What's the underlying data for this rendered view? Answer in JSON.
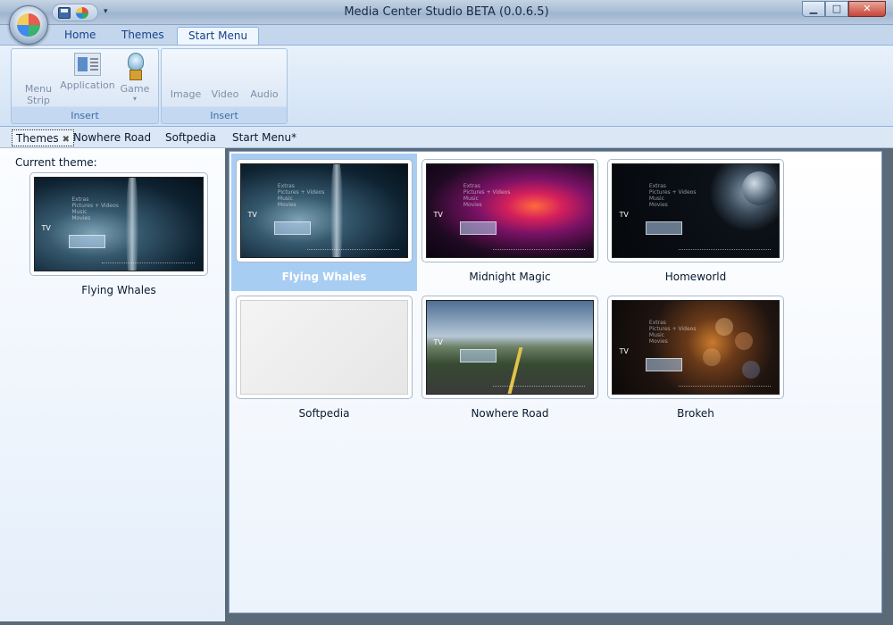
{
  "window": {
    "title": "Media Center Studio BETA (0.0.6.5)",
    "controls": {
      "minimize": "▁",
      "maximize": "□",
      "close": "✕"
    }
  },
  "ribbon": {
    "tabs": [
      {
        "label": "Home",
        "active": false
      },
      {
        "label": "Themes",
        "active": false
      },
      {
        "label": "Start Menu",
        "active": true
      }
    ],
    "groups": [
      {
        "label": "Insert",
        "buttons": [
          {
            "label_line1": "Menu",
            "label_line2": "Strip",
            "icon": "menu-strip-icon"
          },
          {
            "label_line1": "Application",
            "icon": "application-icon"
          },
          {
            "label_line1": "Game",
            "icon": "game-icon",
            "dropdown": "▾"
          }
        ]
      },
      {
        "label": "Insert",
        "buttons": [
          {
            "label_line1": "Image"
          },
          {
            "label_line1": "Video"
          },
          {
            "label_line1": "Audio"
          }
        ]
      }
    ]
  },
  "doc_tabs": [
    {
      "label": "Themes",
      "active": true,
      "close": "✖"
    },
    {
      "label": "Nowhere Road"
    },
    {
      "label": "Softpedia"
    },
    {
      "label": "Start Menu*"
    }
  ],
  "current_theme": {
    "label": "Current theme:",
    "name": "Flying Whales"
  },
  "themes": [
    {
      "name": "Flying Whales",
      "selected": true,
      "preview": "whales"
    },
    {
      "name": "Midnight Magic",
      "selected": false,
      "preview": "magic"
    },
    {
      "name": "Homeworld",
      "selected": false,
      "preview": "home"
    },
    {
      "name": "Softpedia",
      "selected": false,
      "preview": "blank"
    },
    {
      "name": "Nowhere Road",
      "selected": false,
      "preview": "road"
    },
    {
      "name": "Brokeh",
      "selected": false,
      "preview": "brokeh"
    }
  ],
  "preview_text": {
    "menu_lines": [
      "Extras",
      "Pictures + Videos",
      "Music",
      "Movies"
    ],
    "tv": "TV"
  },
  "colors": {
    "selection": "#a8cdf3",
    "ribbon_accent": "#8db2e3"
  }
}
